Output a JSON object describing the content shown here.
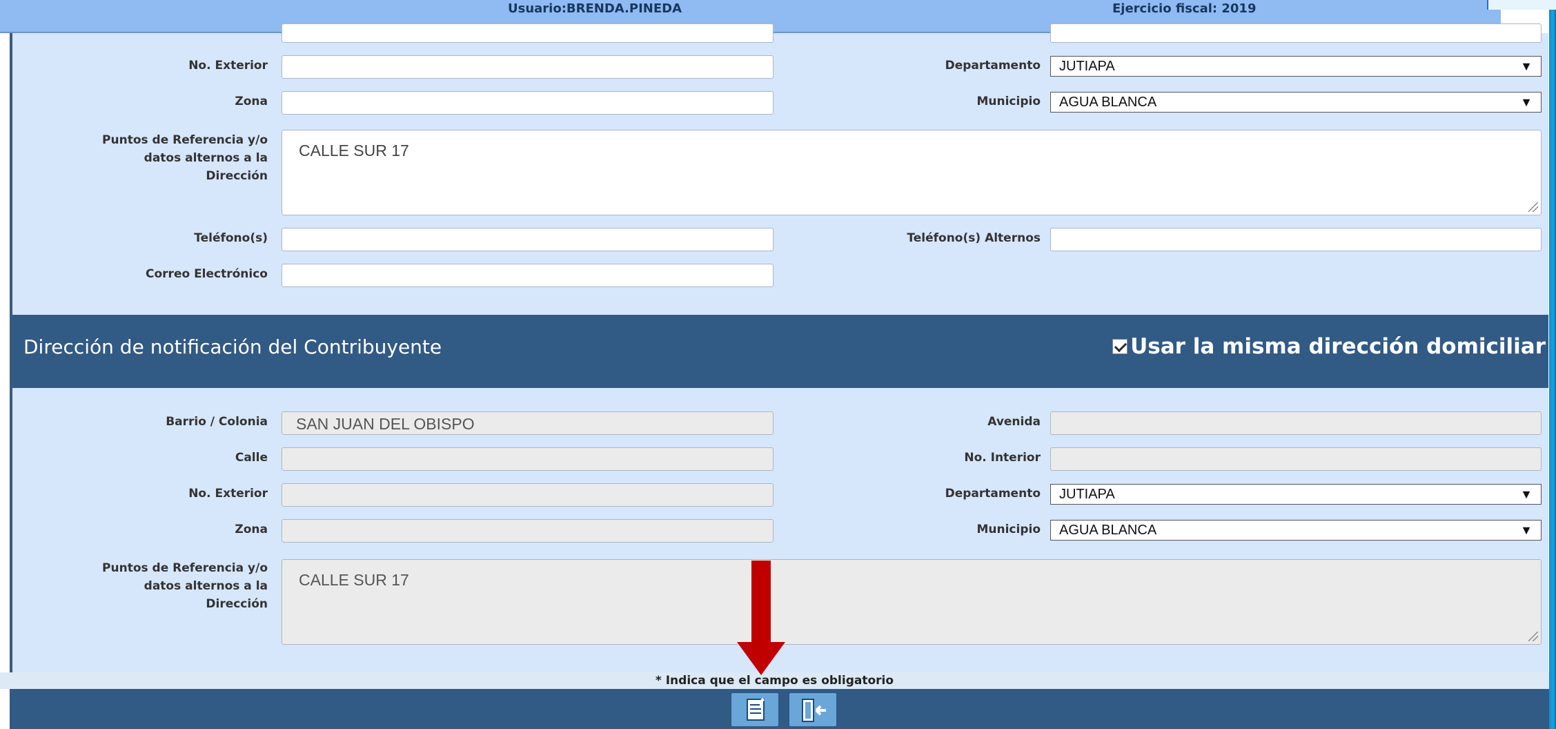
{
  "header": {
    "user": "Usuario:BRENDA.PINEDA",
    "fiscal_year": "Ejercicio fiscal: 2019"
  },
  "domicilio": {
    "no_exterior_label": "No. Exterior",
    "zona_label": "Zona",
    "puntos_label_1": "Puntos de Referencia y/o",
    "puntos_label_2": "datos alternos a la",
    "puntos_label_3": "Dirección",
    "puntos_value": "CALLE SUR  17",
    "telefono_label": "Teléfono(s)",
    "telefono_alt_label": "Teléfono(s) Alternos",
    "correo_label": "Correo Electrónico",
    "departamento_label": "Departamento",
    "departamento_value": "JUTIAPA",
    "municipio_label": "Municipio",
    "municipio_value": "AGUA BLANCA"
  },
  "notificacion": {
    "section_title": "Dirección de notificación del Contribuyente",
    "same_address_label": "Usar la misma dirección domiciliar",
    "same_address_checked": true,
    "barrio_label": "Barrio / Colonia",
    "barrio_value": "SAN JUAN DEL OBISPO",
    "calle_label": "Calle",
    "no_exterior_label": "No. Exterior",
    "zona_label": "Zona",
    "avenida_label": "Avenida",
    "no_interior_label": "No. Interior",
    "departamento_label": "Departamento",
    "departamento_value": "JUTIAPA",
    "municipio_label": "Municipio",
    "municipio_value": "AGUA BLANCA",
    "puntos_label_1": "Puntos de Referencia y/o",
    "puntos_label_2": "datos alternos a la",
    "puntos_label_3": "Dirección",
    "puntos_value": "CALLE SUR  17"
  },
  "footer": {
    "required_note": "* Indica que el campo es obligatorio",
    "save_icon": "document-save-icon",
    "exit_icon": "exit-door-icon"
  },
  "colors": {
    "panel_bg": "#d6e6fb",
    "section_bg": "#315a85",
    "topbar_bg": "#8fbaf2",
    "annotation_arrow": "#c00000"
  }
}
